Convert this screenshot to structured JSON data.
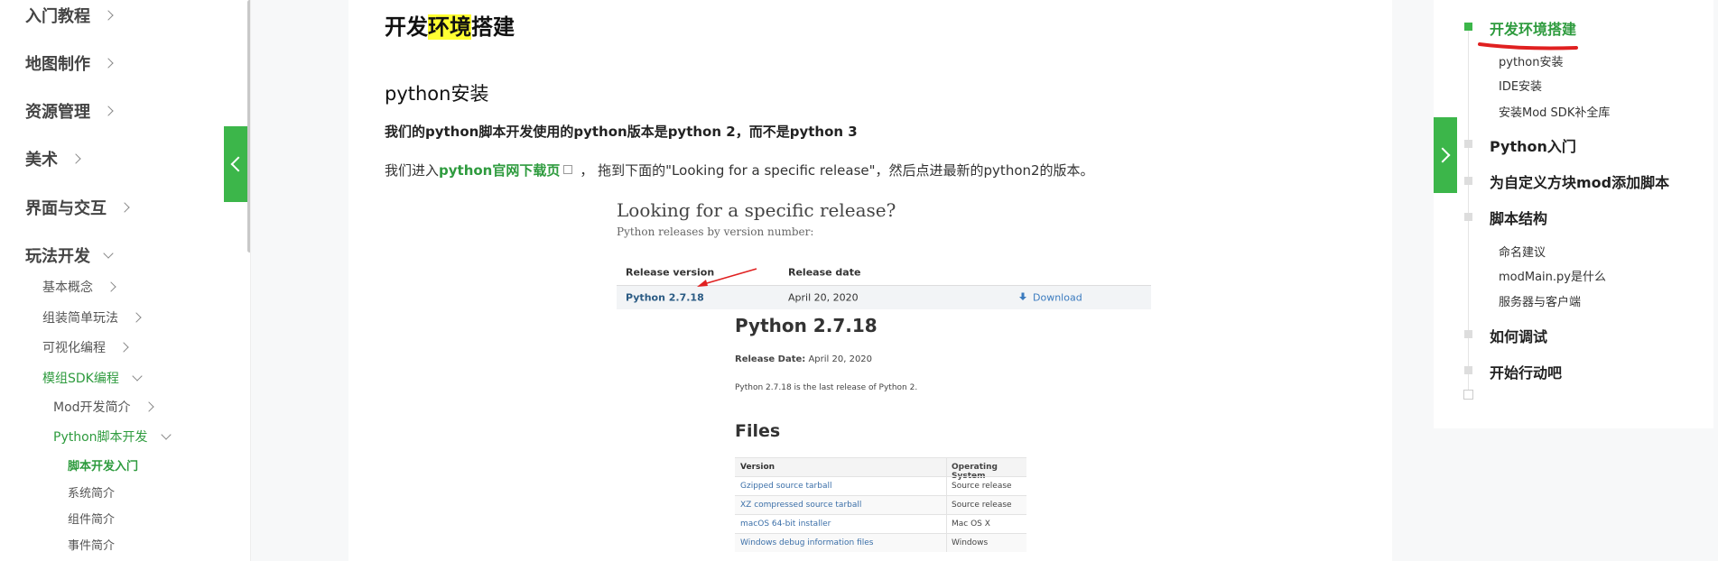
{
  "sidebar": {
    "level1": [
      "入门教程",
      "地图制作",
      "资源管理",
      "美术",
      "界面与交互",
      "玩法开发"
    ],
    "level2": [
      "基本概念",
      "组装简单玩法",
      "可视化编程",
      "模组SDK编程"
    ],
    "level3": [
      "Mod开发简介",
      "Python脚本开发"
    ],
    "level4": [
      "脚本开发入门",
      "系统简介",
      "组件简介",
      "事件简介"
    ]
  },
  "article": {
    "title_prefix": "开发",
    "title_highlight": "环境",
    "title_suffix": "搭建",
    "section_title": "python安装",
    "bold_note": "我们的python脚本开发使用的python版本是python 2，而不是python 3",
    "line_prefix": "我们进入",
    "line_link": "python官网下载页",
    "line_suffix": "，  拖到下面的\"Looking for a specific release\"，然后点进最新的python2的版本。"
  },
  "shot1": {
    "title": "Looking for a specific release?",
    "subtitle": "Python releases by version number:",
    "col_version": "Release version",
    "col_date": "Release date",
    "row_version": "Python 2.7.18",
    "row_date": "April 20, 2020",
    "row_download": "Download"
  },
  "shot2": {
    "title": "Python 2.7.18",
    "release_label": "Release Date:",
    "release_date": "April 20, 2020",
    "description": "Python 2.7.18 is the last release of Python 2.",
    "files_heading": "Files",
    "col_version": "Version",
    "col_os": "Operating System",
    "rows": [
      {
        "name": "Gzipped source tarball",
        "os": "Source release"
      },
      {
        "name": "XZ compressed source tarball",
        "os": "Source release"
      },
      {
        "name": "macOS 64-bit installer",
        "os": "Mac OS X"
      },
      {
        "name": "Windows debug information files",
        "os": "Windows"
      }
    ]
  },
  "toc": {
    "items": [
      "开发环境搭建",
      "Python入门",
      "为自定义方块mod添加脚本",
      "脚本结构",
      "如何调试",
      "开始行动吧"
    ],
    "subs_env": [
      "python安装",
      "IDE安装",
      "安装Mod SDK补全库"
    ],
    "subs_struct": [
      "命名建议",
      "modMain.py是什么",
      "服务器与客户端"
    ]
  },
  "colors": {
    "accent_green": "#3cb64a",
    "link_green": "#2e9b3e",
    "highlight_yellow": "#ffff33",
    "annotation_red": "#e02020"
  }
}
